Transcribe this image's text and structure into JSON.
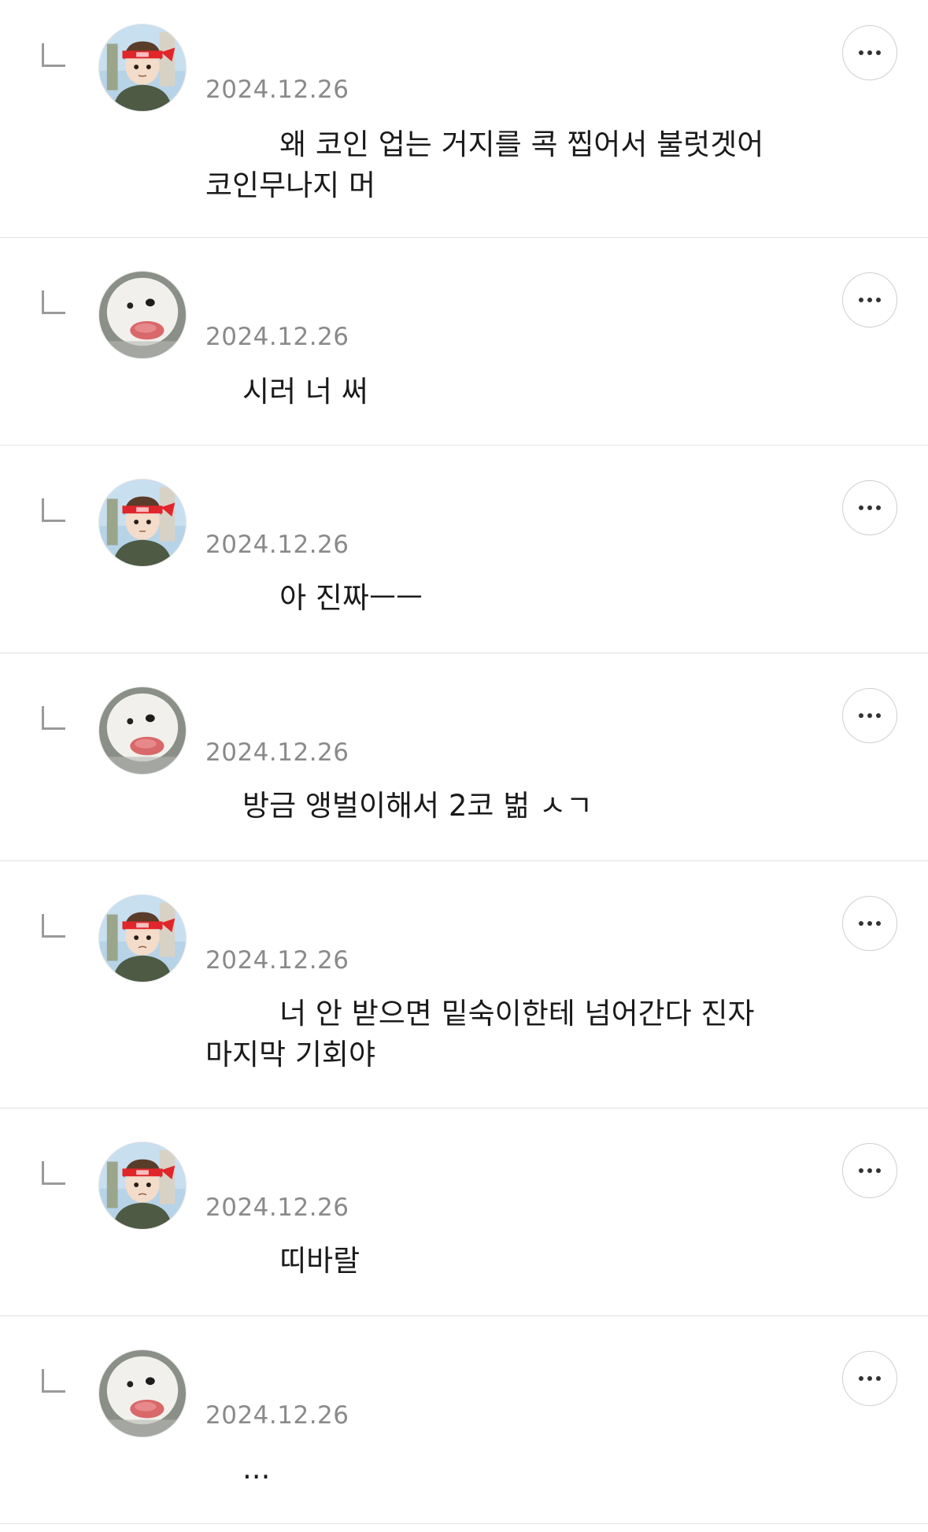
{
  "comments": [
    {
      "avatar": "boy-red-headband-avatar",
      "date": "2024.12.26",
      "text": "        왜 코인 업는 거지를 콕 찝어서 불럿겟어\n코인무나지 머"
    },
    {
      "avatar": "white-dog-avatar",
      "date": "2024.12.26",
      "text": "    시러 너 써"
    },
    {
      "avatar": "boy-red-headband-avatar",
      "date": "2024.12.26",
      "text": "        아 진짜ㅡㅡ"
    },
    {
      "avatar": "white-dog-avatar",
      "date": "2024.12.26",
      "text": "    방금 앵벌이해서 2코 벎 ㅅㄱ"
    },
    {
      "avatar": "boy-red-headband-avatar",
      "date": "2024.12.26",
      "text": "        너 안 받으면 밑숙이한테 넘어간다 진자\n마지막 기회야"
    },
    {
      "avatar": "boy-red-headband-avatar",
      "date": "2024.12.26",
      "text": "        띠바랄"
    },
    {
      "avatar": "white-dog-avatar",
      "date": "2024.12.26",
      "text": "    ..."
    }
  ],
  "icons": {
    "reply": "reply-arrow-icon",
    "more": "more-options-icon"
  },
  "colors": {
    "date": "#8a8a8a",
    "text": "#1a1a1a",
    "divider": "#e2e2e2",
    "headband": "#e0262b"
  }
}
